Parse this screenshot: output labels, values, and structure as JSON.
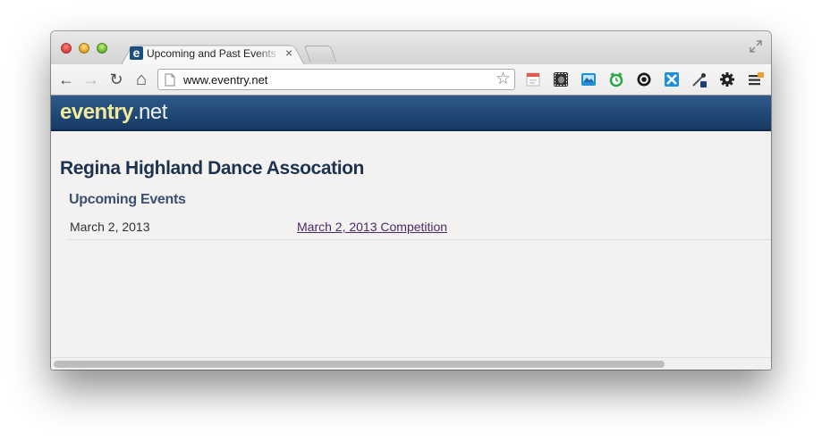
{
  "browser": {
    "tab": {
      "favicon_letter": "e",
      "title": "Upcoming and Past Events - eventry.net",
      "close_glyph": "×"
    },
    "nav": {
      "back_glyph": "←",
      "forward_glyph": "→",
      "reload_glyph": "↻",
      "home_glyph": "⌂"
    },
    "url": "www.eventry.net",
    "star_glyph": "☆",
    "extensions": [
      "calendar-icon",
      "evernote-icon",
      "screenshot-icon",
      "alarm-icon",
      "settings-circle-icon",
      "xmarks-icon",
      "pipette-icon",
      "gear-icon",
      "menu-icon"
    ]
  },
  "site": {
    "logo_brand": "eventry",
    "logo_tld": ".net"
  },
  "page": {
    "org_title": "Regina Highland Dance Assocation",
    "section_title": "Upcoming Events",
    "events": [
      {
        "date": "March 2, 2013",
        "name": "March 2, 2013 Competition"
      }
    ]
  },
  "colors": {
    "header": "#1d4470",
    "logo_brand": "#f3ea9a",
    "title": "#1c3350",
    "link": "#4a2a6a"
  }
}
